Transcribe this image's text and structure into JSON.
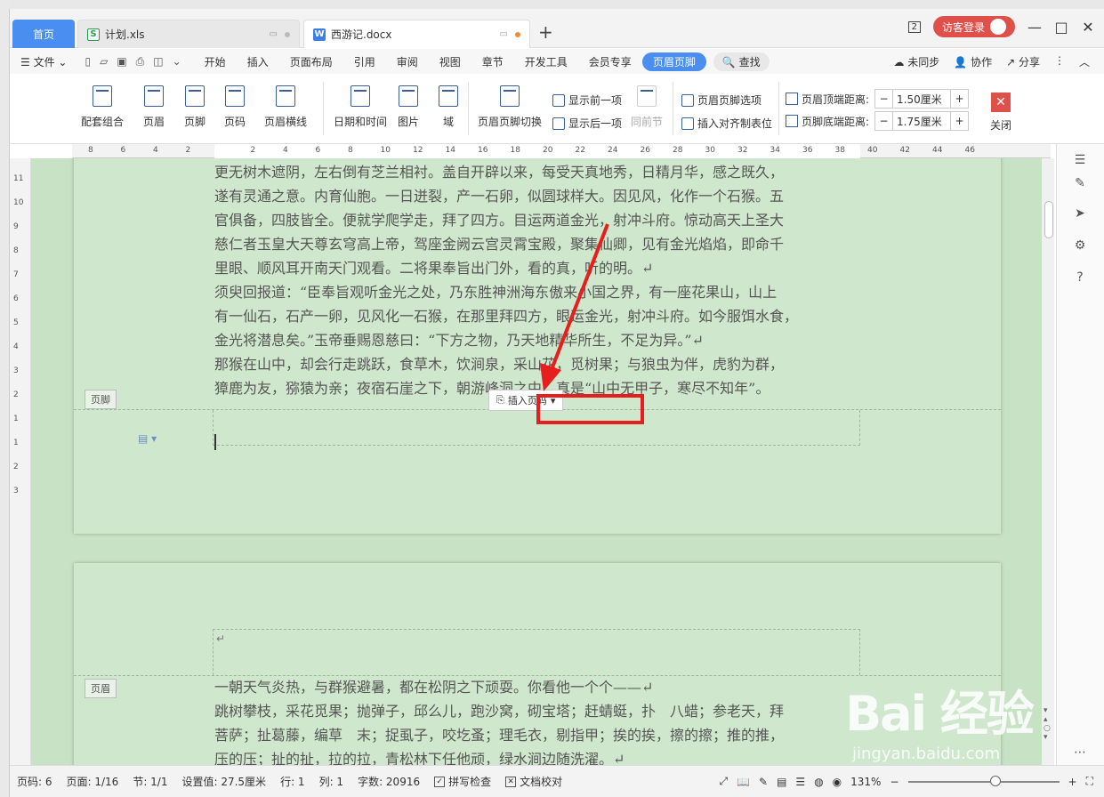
{
  "tabs": {
    "home": "首页",
    "xls": "计划.xls",
    "doc": "西游记.docx"
  },
  "titlebar": {
    "badge": "2",
    "visitor_login": "访客登录"
  },
  "menu": {
    "file": "文件",
    "items": [
      "开始",
      "插入",
      "页面布局",
      "引用",
      "审阅",
      "视图",
      "章节",
      "开发工具",
      "会员专享"
    ],
    "active": "页眉页脚",
    "search": "查找",
    "right": [
      "未同步",
      "协作",
      "分享"
    ]
  },
  "ribbon": {
    "large": [
      "配套组合",
      "页眉",
      "页脚",
      "页码",
      "页眉横线",
      "日期和时间",
      "图片",
      "域",
      "页眉页脚切换"
    ],
    "show_prev": "显示前一项",
    "show_next": "显示后一项",
    "same_as_prev": "同前节",
    "hf_options": "页眉页脚选项",
    "insert_align_tab": "插入对齐制表位",
    "header_top_label": "页眉顶端距离:",
    "header_top_value": "1.50厘米",
    "footer_bottom_label": "页脚底端距离:",
    "footer_bottom_value": "1.75厘米",
    "close": "关闭"
  },
  "ruler": {
    "ticks": [
      "8",
      "6",
      "4",
      "2",
      "",
      "2",
      "4",
      "6",
      "8",
      "10",
      "12",
      "14",
      "16",
      "18",
      "20",
      "22",
      "24",
      "26",
      "28",
      "30",
      "32",
      "34",
      "36",
      "38",
      "40",
      "42",
      "44",
      "46"
    ]
  },
  "vruler": [
    "11",
    "10",
    "9",
    "8",
    "7",
    "6",
    "5",
    "4",
    "3",
    "2",
    "1",
    "1",
    "2",
    "3"
  ],
  "page1_lines": [
    "更无树木遮阴，左右倒有芝兰相衬。盖自开辟以来，每受天真地秀，日精月华，感之既久，",
    "遂有灵通之意。内育仙胞。一日迸裂，产一石卵，似圆球样大。因见风，化作一个石猴。五",
    "官俱备，四肢皆全。便就学爬学走，拜了四方。目运两道金光，射冲斗府。惊动高天上圣大",
    "慈仁者玉皇大天尊玄穹高上帝，驾座金阙云宫灵霄宝殿，聚集仙卿，见有金光焰焰，即命千",
    "里眼、顺风耳开南天门观看。二将果奉旨出门外，看的真，听的明。↵",
    "须臾回报道：“臣奉旨观听金光之处，乃东胜神洲海东傲来小国之界，有一座花果山，山上",
    "有一仙石，石产一卵，见风化一石猴，在那里拜四方，眼运金光，射冲斗府。如今服饵水食，",
    "金光将潜息矣。”玉帝垂赐恩慈曰：“下方之物，乃天地精华所生，不足为异。”↵",
    "那猴在山中，却会行走跳跃，食草木，饮涧泉，采山花，觅树果；与狼虫为伴，虎豹为群，",
    "獐鹿为友，猕猿为亲；夜宿石崖之下，朝游峰洞之中。真是“山中无甲子，寒尽不知年”。"
  ],
  "footer_label": "页脚",
  "insert_page_number": "插入页码",
  "header_label": "页眉",
  "return_mark": "↵",
  "page2_lines": [
    "一朝天气炎热，与群猴避暑，都在松阴之下顽耍。你看他一个个——↵",
    "跳树攀枝，采花觅果；抛弹子，邱么儿，跑沙窝，砌宝塔；赶蜻蜓，扑　八蜡；参老天，拜",
    "菩萨；扯葛藤，编草　末；捉虱子，咬圪蚤；理毛衣，剔指甲；挨的挨，擦的擦；推的推，",
    "压的压；扯的扯，拉的拉，青松林下任他顽，绿水涧边随洗濯。↵"
  ],
  "status": {
    "page_code": "页码: 6",
    "page": "页面: 1/16",
    "section": "节: 1/1",
    "setting": "设置值: 27.5厘米",
    "row": "行: 1",
    "col": "列: 1",
    "chars": "字数: 20916",
    "spell": "拼写检查",
    "proof": "文档校对",
    "zoom": "131%",
    "zoom_level": 0.58
  },
  "watermark": {
    "big": "Bai 经验",
    "small": "jingyan.baidu.com"
  },
  "colors": {
    "accent": "#4a8ef1",
    "doc_bg": "#c7e2c5",
    "highlight_red": "#e61e1e"
  }
}
